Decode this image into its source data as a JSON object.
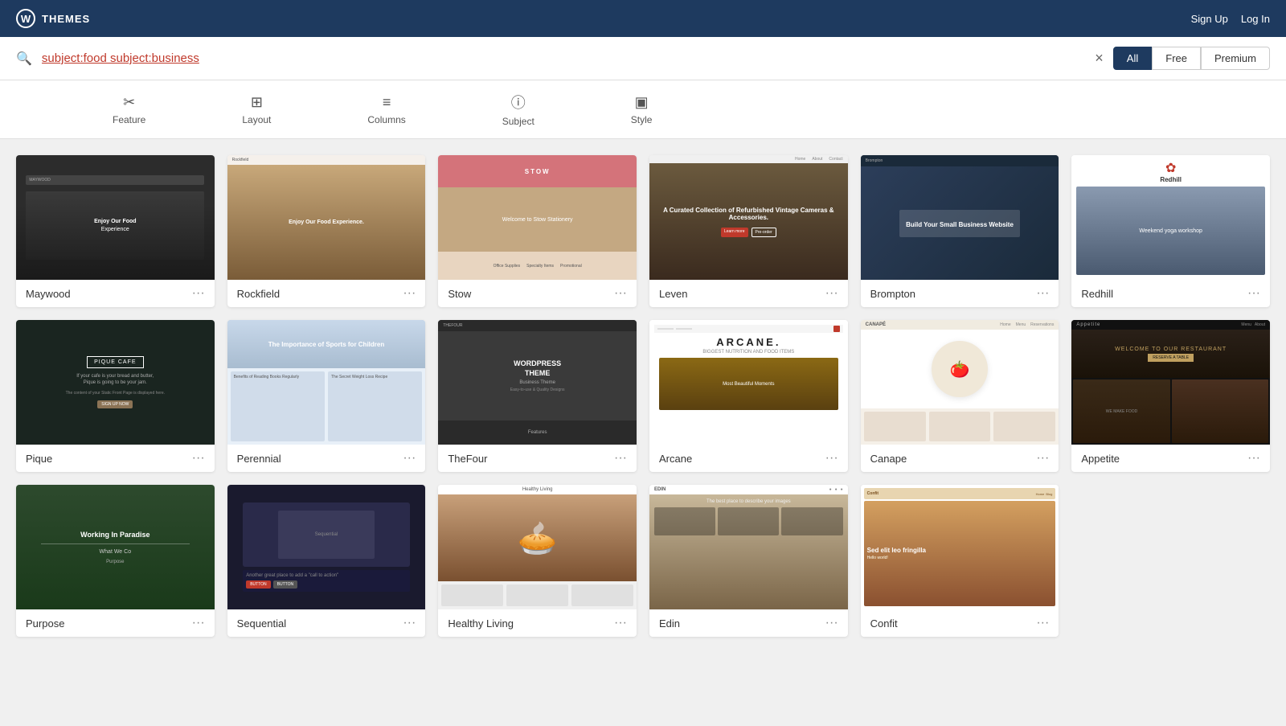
{
  "header": {
    "logo_text": "W",
    "title": "THEMES",
    "nav": {
      "signup": "Sign Up",
      "login": "Log In"
    }
  },
  "search": {
    "value": "subject:food subject:business",
    "clear_label": "×"
  },
  "filter_buttons": [
    {
      "id": "all",
      "label": "All",
      "active": true
    },
    {
      "id": "free",
      "label": "Free",
      "active": false
    },
    {
      "id": "premium",
      "label": "Premium",
      "active": false
    }
  ],
  "filter_tabs": [
    {
      "id": "feature",
      "icon": "✂",
      "label": "Feature"
    },
    {
      "id": "layout",
      "icon": "⊞",
      "label": "Layout"
    },
    {
      "id": "columns",
      "icon": "≡",
      "label": "Columns"
    },
    {
      "id": "subject",
      "icon": "ⓘ",
      "label": "Subject"
    },
    {
      "id": "style",
      "icon": "▣",
      "label": "Style"
    }
  ],
  "themes": [
    {
      "id": "maywood",
      "name": "Maywood",
      "preview_type": "maywood"
    },
    {
      "id": "rockfield",
      "name": "Rockfield",
      "preview_type": "rockfield"
    },
    {
      "id": "stow",
      "name": "Stow",
      "preview_type": "stow"
    },
    {
      "id": "leven",
      "name": "Leven",
      "preview_type": "leven"
    },
    {
      "id": "brompton",
      "name": "Brompton",
      "preview_type": "brompton"
    },
    {
      "id": "redhill",
      "name": "Redhill",
      "preview_type": "redhill"
    },
    {
      "id": "pique",
      "name": "Pique",
      "preview_type": "pique"
    },
    {
      "id": "perennial",
      "name": "Perennial",
      "preview_type": "perennial"
    },
    {
      "id": "thefour",
      "name": "TheFour",
      "preview_type": "thefour"
    },
    {
      "id": "arcane",
      "name": "Arcane",
      "preview_type": "arcane"
    },
    {
      "id": "canape",
      "name": "Canape",
      "preview_type": "canape"
    },
    {
      "id": "appetite",
      "name": "Appetite",
      "preview_type": "appetite"
    },
    {
      "id": "purpose",
      "name": "Purpose",
      "preview_type": "purpose"
    },
    {
      "id": "sequential",
      "name": "Sequential",
      "preview_type": "sequential"
    },
    {
      "id": "healthyliving",
      "name": "Healthy Living",
      "preview_type": "healthyliving"
    },
    {
      "id": "edin",
      "name": "Edin",
      "preview_type": "edin"
    },
    {
      "id": "confit",
      "name": "Confit",
      "preview_type": "confit"
    }
  ],
  "more_icon": "···"
}
